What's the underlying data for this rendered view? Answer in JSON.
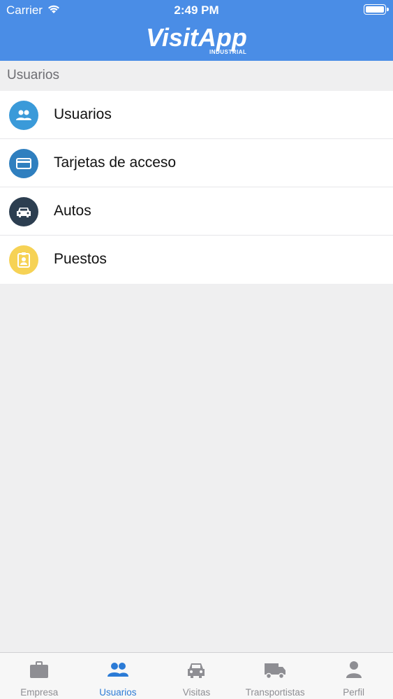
{
  "status_bar": {
    "carrier": "Carrier",
    "time": "2:49 PM"
  },
  "logo": {
    "name": "VisitApp",
    "subtitle": "INDUSTRIAL"
  },
  "section": {
    "title": "Usuarios"
  },
  "menu": [
    {
      "label": "Usuarios",
      "icon": "users-icon",
      "color": "#3a9ad9"
    },
    {
      "label": "Tarjetas de acceso",
      "icon": "credit-card-icon",
      "color": "#2f7fbf"
    },
    {
      "label": "Autos",
      "icon": "car-icon",
      "color": "#2c3e50"
    },
    {
      "label": "Puestos",
      "icon": "badge-icon",
      "color": "#f6d255"
    }
  ],
  "tabbar": [
    {
      "label": "Empresa",
      "icon": "briefcase-icon",
      "active": false
    },
    {
      "label": "Usuarios",
      "icon": "users-icon",
      "active": true
    },
    {
      "label": "Visitas",
      "icon": "car-icon",
      "active": false
    },
    {
      "label": "Transportistas",
      "icon": "truck-icon",
      "active": false
    },
    {
      "label": "Perfil",
      "icon": "person-icon",
      "active": false
    }
  ],
  "colors": {
    "header": "#4a8de6",
    "active_tab": "#2b7bd6",
    "inactive_tab": "#8e8e93"
  }
}
